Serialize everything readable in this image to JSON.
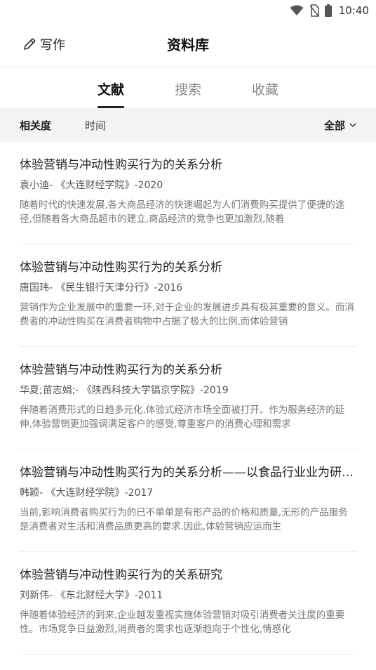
{
  "status_bar": {
    "time": "10:40"
  },
  "header": {
    "write_label": "写作",
    "title": "资料库"
  },
  "tabs": [
    {
      "label": "文献"
    },
    {
      "label": "搜索"
    },
    {
      "label": "收藏"
    }
  ],
  "filter": {
    "relevance": "相关度",
    "time": "时间",
    "all": "全部"
  },
  "items": [
    {
      "title": "体验营销与冲动性购买行为的关系分析",
      "meta": "袁小迪- 《大连财经学院》-2020",
      "abstract": "随着时代的快速发展,各大商品经济的快速崛起为人们消费购买提供了便捷的途径,但随着各大商品超市的建立,商品经济的竞争也更加激烈,随着"
    },
    {
      "title": "体验营销与冲动性购买行为的关系分析",
      "meta": "唐国玮- 《民生银行天津分行》-2016",
      "abstract": "营销作为企业发展中的重要一环,对于企业的发展进步具有极其重要的意义。而消费者的冲动性购买在消费者购物中占据了极大的比例,而体验营销"
    },
    {
      "title": "体验营销与冲动性购买行为的关系分析",
      "meta": "华夏;苗志娟;- 《陕西科技大学镐京学院》-2019",
      "abstract": "伴随着消费形式的日趋多元化,体验式经济市场全面被打开。作为服务经济的延伸,体验营销更加强调满足客户的感受,尊重客户的消费心理和需求"
    },
    {
      "title": "体验营销与冲动性购买行为的关系分析——以食品行业业为研究对象",
      "meta": "韩颖- 《大连财经学院》-2017",
      "abstract": "当前,影响消费者购买行为的已不单单是有形产品的价格和质量,无形的产品服务是消费者对生活和消费品质更高的要求.因此,体验营销应运而生"
    },
    {
      "title": "体验营销与冲动性购买行为的关系研究",
      "meta": "刘新伟- 《东北财经大学》-2011",
      "abstract": "伴随着体验经济的到来,企业越发重视实施体验营销对吸引消费者关注度的重要性。市场竞争日益激烈,消费者的需求也逐渐趋向于个性化,情感化"
    }
  ]
}
